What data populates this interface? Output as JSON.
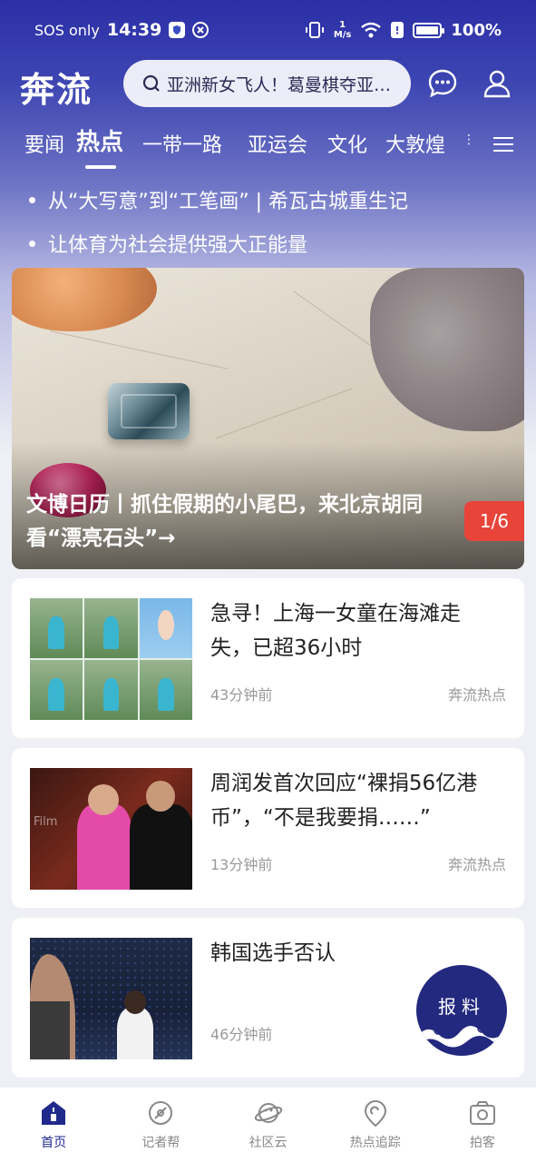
{
  "status_bar": {
    "sos": "SOS only",
    "time": "14:39",
    "network_speed_value": "1",
    "network_speed_unit": "M/s",
    "battery": "100%"
  },
  "header": {
    "logo": "奔流",
    "search_placeholder": "亚洲新女飞人！葛曼棋夺亚…"
  },
  "tabs": [
    {
      "label": "要闻",
      "active": false
    },
    {
      "label": "热点",
      "active": true
    },
    {
      "label": "一带一路",
      "active": false
    },
    {
      "label": "亚运会",
      "active": false
    },
    {
      "label": "文化",
      "active": false
    },
    {
      "label": "大敦煌",
      "active": false
    }
  ],
  "headlines": [
    "从“大写意”到“工笔画” | 希瓦古城重生记",
    "让体育为社会提供强大正能量"
  ],
  "banner": {
    "title": "文博日历丨抓住假期的小尾巴，来北京胡同看“漂亮石头”→",
    "counter": "1/6"
  },
  "news": [
    {
      "title": "急寻！上海一女童在海滩走失，已超36小时",
      "time": "43分钟前",
      "source": "奔流热点"
    },
    {
      "title": "周润发首次回应“裸捐56亿港币”，“不是我要捐……”",
      "time": "13分钟前",
      "source": "奔流热点"
    },
    {
      "title": "韩国选手否认",
      "time": "46分钟前",
      "source": ""
    }
  ],
  "report_button": {
    "label": "报料"
  },
  "bottom_nav": [
    {
      "label": "首页",
      "icon": "home-icon",
      "active": true
    },
    {
      "label": "记者帮",
      "icon": "compass-icon",
      "active": false
    },
    {
      "label": "社区云",
      "icon": "planet-icon",
      "active": false
    },
    {
      "label": "热点追踪",
      "icon": "location-pin-icon",
      "active": false
    },
    {
      "label": "拍客",
      "icon": "camera-icon",
      "active": false
    }
  ],
  "colors": {
    "brand": "#2b2ea6",
    "nav_active": "#1f2a8a",
    "counter_bg": "#e8443a"
  }
}
